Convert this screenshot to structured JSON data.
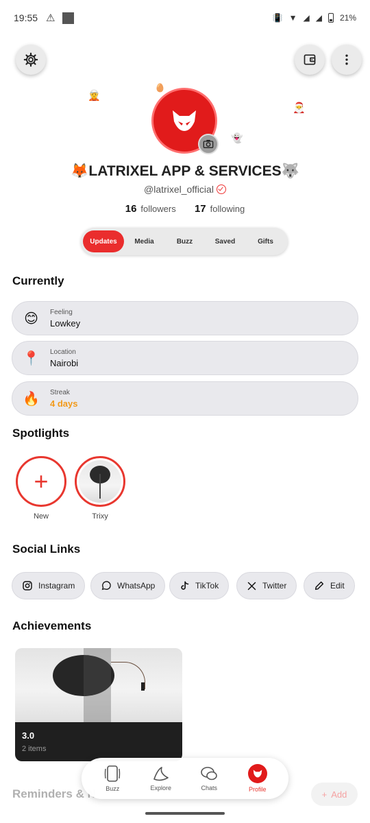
{
  "status_bar": {
    "time": "19:55",
    "battery": "21%"
  },
  "profile": {
    "display_name": "🦊LATRIXEL APP & SERVICES🐺",
    "handle": "@latrixel_official",
    "followers_count": "16",
    "followers_label": "followers",
    "following_count": "17",
    "following_label": "following"
  },
  "tabs": [
    "Updates",
    "Media",
    "Buzz",
    "Saved",
    "Gifts"
  ],
  "currently": {
    "title": "Currently",
    "items": [
      {
        "label": "Feeling",
        "value": "Lowkey",
        "icon": "😊"
      },
      {
        "label": "Location",
        "value": "Nairobi",
        "icon": "📍"
      },
      {
        "label": "Streak",
        "value": "4 days",
        "icon": "🔥"
      }
    ]
  },
  "spotlights": {
    "title": "Spotlights",
    "items": [
      {
        "label": "New"
      },
      {
        "label": "Trixy"
      }
    ]
  },
  "social_links": {
    "title": "Social Links",
    "items": [
      {
        "label": "Instagram",
        "icon": "instagram-icon"
      },
      {
        "label": "WhatsApp",
        "icon": "whatsapp-icon"
      },
      {
        "label": "TikTok",
        "icon": "tiktok-icon"
      },
      {
        "label": "Twitter",
        "icon": "x-icon"
      },
      {
        "label": "Edit",
        "icon": "pencil-icon"
      }
    ]
  },
  "achievements": {
    "title": "Achievements",
    "items": [
      {
        "title": "3.0",
        "subtitle": "2 items"
      }
    ]
  },
  "reminders": {
    "title": "Reminders & N",
    "add_label": "Add"
  },
  "nav": [
    "Buzz",
    "Explore",
    "Chats",
    "Profile"
  ],
  "colors": {
    "accent": "#e8372f",
    "streak": "#f29a1a"
  }
}
